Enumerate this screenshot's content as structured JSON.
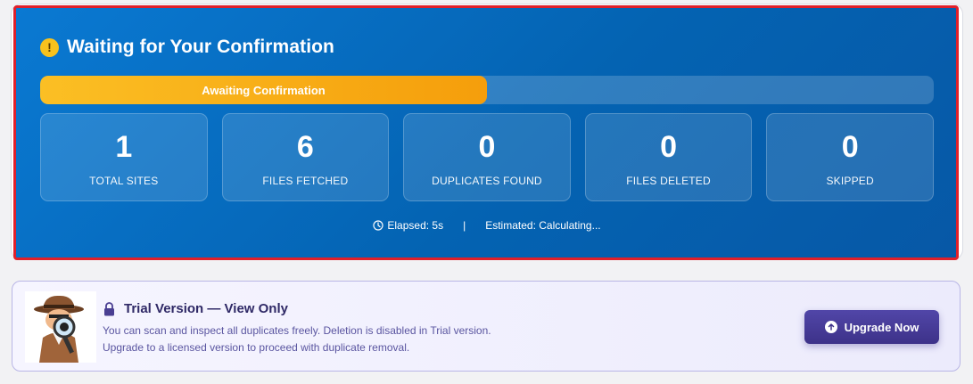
{
  "status": {
    "title": "Waiting for Your Confirmation",
    "title_icon": "warning-icon",
    "progress_label": "Awaiting Confirmation",
    "progress_fraction": 0.5
  },
  "stats": [
    {
      "value": "1",
      "label": "TOTAL SITES"
    },
    {
      "value": "6",
      "label": "FILES FETCHED"
    },
    {
      "value": "0",
      "label": "DUPLICATES FOUND"
    },
    {
      "value": "0",
      "label": "FILES DELETED"
    },
    {
      "value": "0",
      "label": "SKIPPED"
    }
  ],
  "timing": {
    "elapsed": "Elapsed: 5s",
    "separator": "|",
    "estimated": "Estimated: Calculating..."
  },
  "trial": {
    "title": "Trial Version — View Only",
    "line1": "You can scan and inspect all duplicates freely. Deletion is disabled in Trial version.",
    "line2": "Upgrade to a licensed version to proceed with duplicate removal.",
    "button_label": "Upgrade Now"
  },
  "colors": {
    "panel_bg": "#0a6fc6",
    "progress": "#f59e0b",
    "accent": "#4338a0",
    "highlight_border": "#e0202a"
  }
}
